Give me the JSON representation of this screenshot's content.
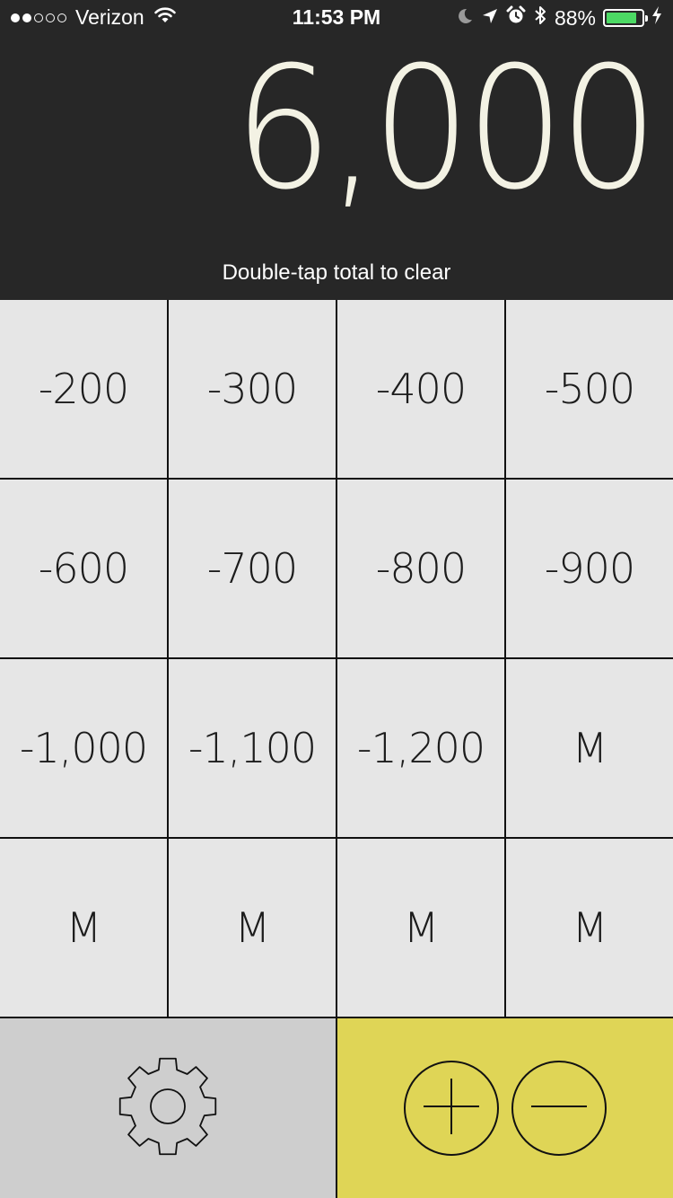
{
  "status_bar": {
    "signal_filled": 2,
    "signal_total": 5,
    "carrier": "Verizon",
    "time": "11:53 PM",
    "battery_percent": "88%",
    "battery_level": 0.88,
    "icons": [
      "wifi-icon",
      "moon-icon",
      "location-arrow-icon",
      "alarm-icon",
      "bluetooth-icon",
      "battery-icon",
      "charging-bolt-icon"
    ]
  },
  "display": {
    "total": "6,000",
    "hint": "Double-tap total to clear"
  },
  "keypad": {
    "keys": [
      "-200",
      "-300",
      "-400",
      "-500",
      "-600",
      "-700",
      "-800",
      "-900",
      "-1,000",
      "-1,100",
      "-1,200",
      "M",
      "M",
      "M",
      "M",
      "M"
    ]
  },
  "bottom_bar": {
    "settings_icon": "gear-icon",
    "mode_buttons": [
      "plus-icon",
      "minus-icon"
    ]
  },
  "colors": {
    "display_bg": "#272727",
    "total_text": "#f3f2e4",
    "key_bg": "#e6e6e6",
    "grid_lines": "#111111",
    "settings_bg": "#cecece",
    "mode_bg": "#dfd556",
    "battery_fill": "#4cd964"
  }
}
